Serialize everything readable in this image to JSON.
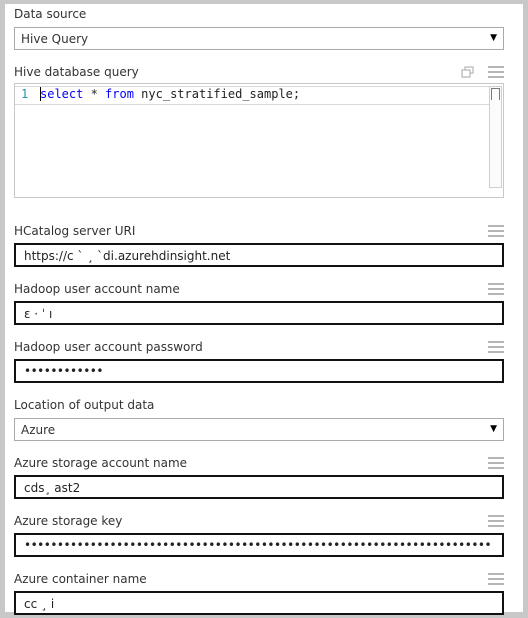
{
  "data_source": {
    "label": "Data source",
    "value": "Hive Query"
  },
  "hive_query": {
    "label": "Hive database query",
    "line_number": "1",
    "code_keyword_1": "select",
    "code_mid": " * ",
    "code_keyword_2": "from",
    "code_rest": " nyc_stratified_sample;"
  },
  "hcatalog_uri": {
    "label": "HCatalog server URI",
    "value": "https://c  ` ¸ `di.azurehdinsight.net"
  },
  "hadoop_user": {
    "label": "Hadoop user account name",
    "value": "ɛ ·   ˈ ı"
  },
  "hadoop_password": {
    "label": "Hadoop user account password",
    "value": "••••••••••••"
  },
  "output_location": {
    "label": "Location of output data",
    "value": "Azure"
  },
  "storage_account": {
    "label": "Azure storage account name",
    "value": "cds¸      ast2"
  },
  "storage_key": {
    "label": "Azure storage key",
    "value": "••••••••••••••••••••••••••••••••••••••••••••••••••••••••••••••••••••••••••••••••••••••••"
  },
  "container_name": {
    "label": "Azure container name",
    "value": "cc ¸     i"
  }
}
